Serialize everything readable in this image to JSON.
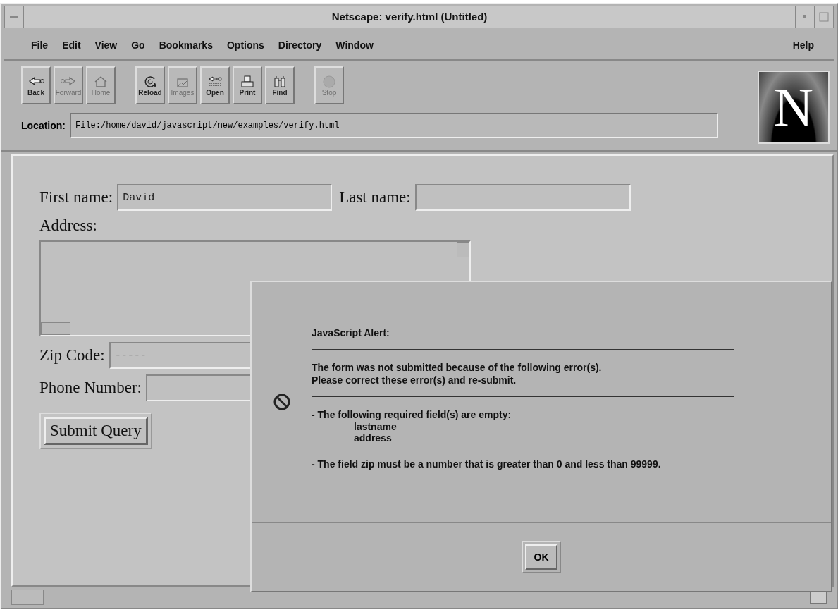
{
  "window": {
    "title": "Netscape: verify.html (Untitled)"
  },
  "menu": [
    {
      "label": "File"
    },
    {
      "label": "Edit"
    },
    {
      "label": "View"
    },
    {
      "label": "Go"
    },
    {
      "label": "Bookmarks"
    },
    {
      "label": "Options"
    },
    {
      "label": "Directory"
    },
    {
      "label": "Window"
    }
  ],
  "help_menu": "Help",
  "toolbar": [
    {
      "label": "Back",
      "kind": "back",
      "disabled": false
    },
    {
      "label": "Forward",
      "kind": "forward",
      "disabled": true
    },
    {
      "label": "Home",
      "kind": "home",
      "disabled": true
    },
    {
      "label": "Reload",
      "kind": "reload",
      "disabled": false
    },
    {
      "label": "Images",
      "kind": "images",
      "disabled": true
    },
    {
      "label": "Open",
      "kind": "open",
      "disabled": false
    },
    {
      "label": "Print",
      "kind": "print",
      "disabled": false
    },
    {
      "label": "Find",
      "kind": "find",
      "disabled": false
    },
    {
      "label": "Stop",
      "kind": "stop",
      "disabled": true
    }
  ],
  "location": {
    "label": "Location:",
    "value": "File:/home/david/javascript/new/examples/verify.html"
  },
  "logo_letter": "N",
  "form": {
    "first_name": {
      "label": "First name:",
      "value": "David"
    },
    "last_name": {
      "label": "Last name:"
    },
    "address": {
      "label": "Address:"
    },
    "zip": {
      "label": "Zip Code:",
      "placeholder": "-----"
    },
    "phone": {
      "label": "Phone Number:"
    },
    "submit": "Submit Query"
  },
  "alert": {
    "title": "JavaScript Alert:",
    "message": [
      "The form was not submitted because of the following error(s).",
      "Please correct these error(s) and re-submit."
    ],
    "errors": [
      {
        "text": "- The following required field(s) are empty:",
        "fields": [
          "lastname",
          "address"
        ]
      },
      {
        "text": "- The field zip must be a number that is greater than 0 and less than 99999."
      }
    ],
    "button": "OK"
  }
}
